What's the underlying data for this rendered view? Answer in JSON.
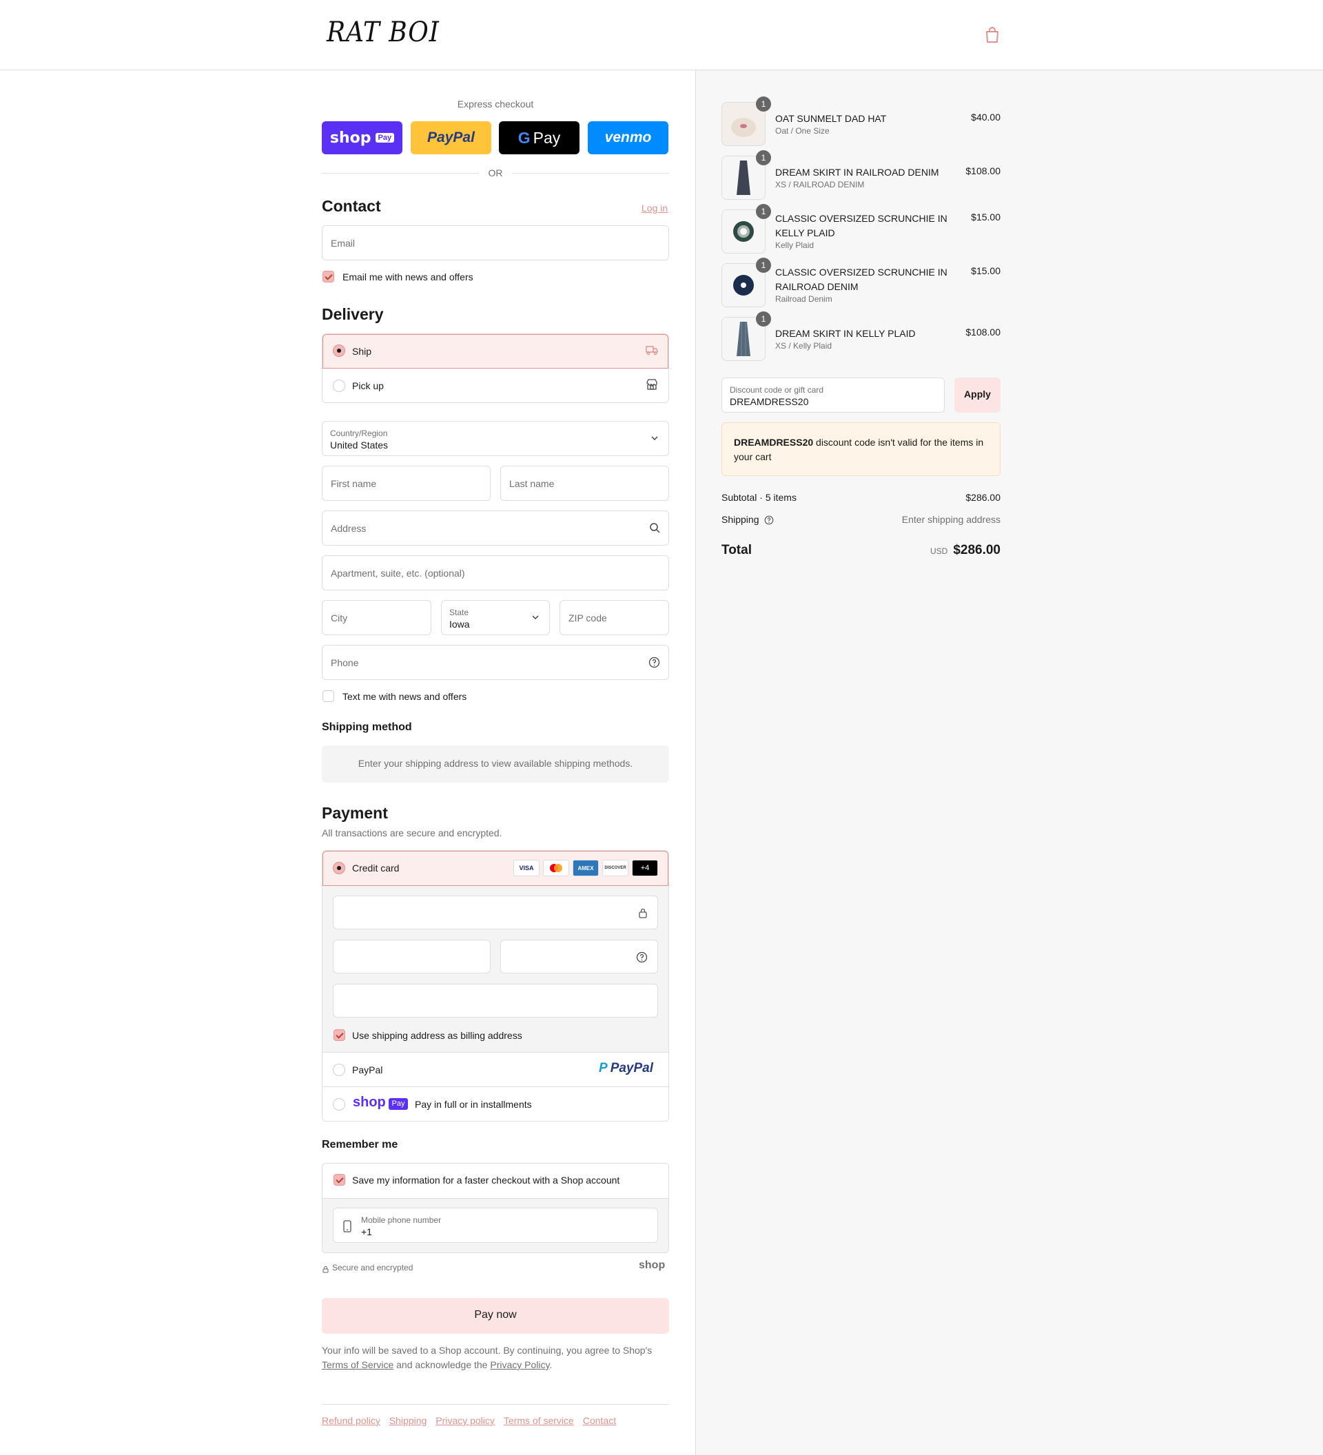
{
  "header": {
    "logo_text": "RAT BOI",
    "cart_icon": "shopping-bag-icon"
  },
  "express": {
    "title": "Express checkout",
    "buttons": [
      {
        "name": "shop",
        "label": "shop",
        "badge": "Pay",
        "color": "#5a31f4"
      },
      {
        "name": "paypal",
        "label": "PayPal",
        "color": "#ffc439"
      },
      {
        "name": "gpay",
        "label": "Pay",
        "color": "#000000"
      },
      {
        "name": "venmo",
        "label": "venmo",
        "color": "#008cff"
      }
    ],
    "or": "OR"
  },
  "contact": {
    "title": "Contact",
    "login_link": "Log in",
    "email_placeholder": "Email",
    "newsletter_label": "Email me with news and offers"
  },
  "delivery": {
    "title": "Delivery",
    "ship_label": "Ship",
    "pickup_label": "Pick up",
    "country_label": "Country/Region",
    "country_value": "United States",
    "first_name_placeholder": "First name",
    "last_name_placeholder": "Last name",
    "address_placeholder": "Address",
    "apartment_placeholder": "Apartment, suite, etc. (optional)",
    "city_placeholder": "City",
    "state_label": "State",
    "state_value": "Iowa",
    "zip_placeholder": "ZIP code",
    "phone_placeholder": "Phone",
    "text_offers_label": "Text me with news and offers"
  },
  "shipping_method": {
    "title": "Shipping method",
    "message": "Enter your shipping address to view available shipping methods."
  },
  "payment": {
    "title": "Payment",
    "subtitle": "All transactions are secure and encrypted.",
    "credit_card_label": "Credit card",
    "card_brands": [
      "VISA",
      "MC",
      "AMEX",
      "DISCOVER"
    ],
    "more_brands": "+4",
    "billing_label": "Use shipping address as billing address",
    "paypal_label": "PayPal",
    "paypal_logo": "PayPal",
    "shoppay_logo": "shop",
    "shoppay_badge": "Pay",
    "shoppay_label": "Pay in full or in installments"
  },
  "remember": {
    "title": "Remember me",
    "save_label": "Save my information for a faster checkout with a Shop account",
    "phone_label": "Mobile phone number",
    "phone_value": "+1",
    "secure_label": "Secure and encrypted",
    "shop_logo": "shop"
  },
  "pay_button": "Pay now",
  "legal": {
    "text1": "Your info will be saved to a Shop account. By continuing, you agree to Shop's",
    "tos": "Terms of Service",
    "text2": "and acknowledge the",
    "privacy": "Privacy Policy",
    "text3": "."
  },
  "footer_links": [
    "Refund policy",
    "Shipping",
    "Privacy policy",
    "Terms of service",
    "Contact"
  ],
  "order": {
    "items": [
      {
        "name": "OAT SUNMELT DAD HAT",
        "variant": "Oat / One Size",
        "price": "$40.00",
        "qty": "1"
      },
      {
        "name": "DREAM SKIRT IN RAILROAD DENIM",
        "variant": "XS / RAILROAD DENIM",
        "price": "$108.00",
        "qty": "1"
      },
      {
        "name": "CLASSIC OVERSIZED SCRUNCHIE IN KELLY PLAID",
        "variant": "Kelly Plaid",
        "price": "$15.00",
        "qty": "1"
      },
      {
        "name": "CLASSIC OVERSIZED SCRUNCHIE IN RAILROAD DENIM",
        "variant": "Railroad Denim",
        "price": "$15.00",
        "qty": "1"
      },
      {
        "name": "DREAM SKIRT IN KELLY PLAID",
        "variant": "XS / Kelly Plaid",
        "price": "$108.00",
        "qty": "1"
      }
    ],
    "discount_label": "Discount code or gift card",
    "discount_value": "DREAMDRESS20",
    "apply_label": "Apply",
    "error_code": "DREAMDRESS20",
    "error_text": "discount code isn't valid for the items in your cart",
    "subtotal_label": "Subtotal · 5 items",
    "subtotal_value": "$286.00",
    "shipping_label": "Shipping",
    "shipping_value": "Enter shipping address",
    "total_label": "Total",
    "currency": "USD",
    "total_value": "$286.00"
  },
  "colors": {
    "accent": "#e0928e",
    "selected_bg": "#fdeeee",
    "pay_button": "#fde4e4",
    "error_bg": "#fff4e8"
  }
}
